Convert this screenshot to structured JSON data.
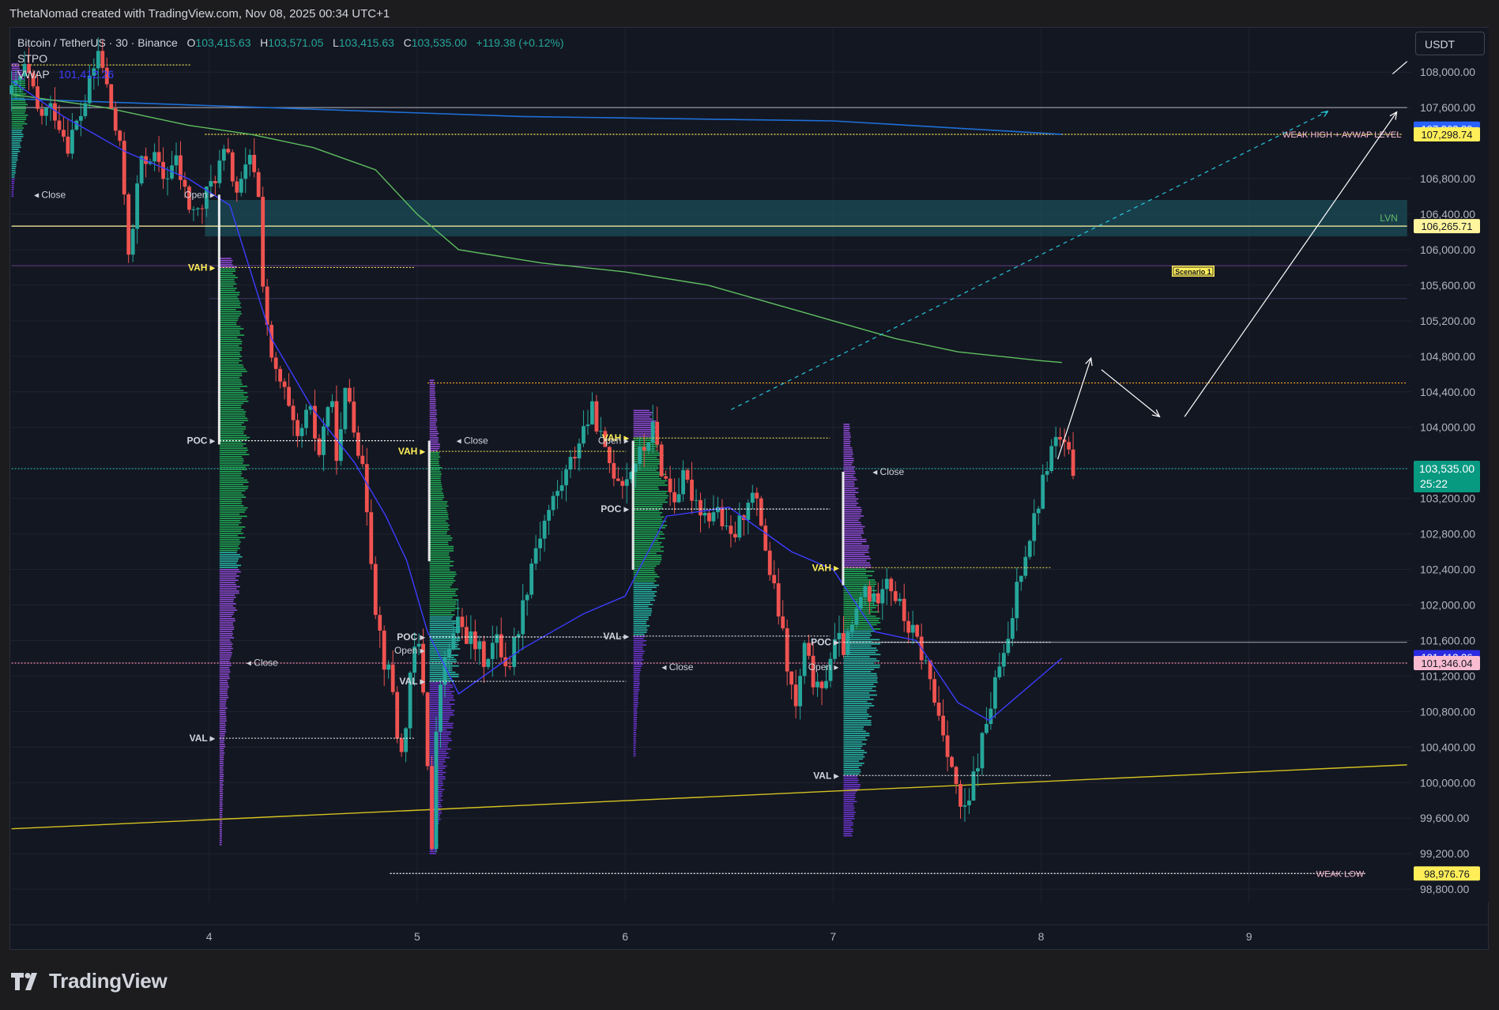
{
  "caption": "ThetaNomad created with TradingView.com, Nov 08, 2025 00:34 UTC+1",
  "brand": "TradingView",
  "currency": "USDT",
  "legend": {
    "symbol": "Bitcoin / TetherUS · 30 · Binance",
    "o_key": "O",
    "o_val": "103,415.63",
    "h_key": "H",
    "h_val": "103,571.05",
    "l_key": "L",
    "l_val": "103,415.63",
    "c_key": "C",
    "c_val": "103,535.00",
    "change": "+119.38 (+0.12%)",
    "ind1": "STPO",
    "ind2": "VWAP",
    "ind2_val": "101,412.26"
  },
  "colors": {
    "bg": "#131722",
    "grid": "#1f2330",
    "up": "#26a69a",
    "down": "#ef5350",
    "vwap": "#3d3dff",
    "avwap": "#5fbf5f",
    "blue_level": "#1e6fd6",
    "yellow": "#ffee58",
    "text": "#d1d4dc",
    "axis_text": "#b2b5be"
  },
  "chart_data": {
    "type": "candlestick",
    "symbol": "Bitcoin / TetherUS",
    "interval": "30",
    "exchange": "Binance",
    "ylim": [
      98650,
      108500
    ],
    "xlim": [
      3.04,
      9.78
    ],
    "y_ticks": [
      "108,000.00",
      "107,600.00",
      "106,800.00",
      "106,400.00",
      "106,000.00",
      "105,600.00",
      "105,200.00",
      "104,800.00",
      "104,400.00",
      "104,000.00",
      "103,200.00",
      "102,800.00",
      "102,400.00",
      "102,000.00",
      "101,600.00",
      "101,200.00",
      "100,800.00",
      "100,400.00",
      "100,000.00",
      "99,600.00",
      "99,200.00",
      "98,800.00"
    ],
    "x_ticks": [
      {
        "x": 4,
        "label": "4"
      },
      {
        "x": 5,
        "label": "5"
      },
      {
        "x": 6,
        "label": "6"
      },
      {
        "x": 7,
        "label": "7"
      },
      {
        "x": 8,
        "label": "8"
      },
      {
        "x": 9,
        "label": "9"
      }
    ],
    "price_path": [
      [
        3.05,
        107750
      ],
      [
        3.12,
        108050
      ],
      [
        3.18,
        107500
      ],
      [
        3.25,
        107600
      ],
      [
        3.32,
        107200
      ],
      [
        3.38,
        107500
      ],
      [
        3.42,
        107800
      ],
      [
        3.47,
        108250
      ],
      [
        3.52,
        107700
      ],
      [
        3.58,
        107000
      ],
      [
        3.62,
        105800
      ],
      [
        3.66,
        106900
      ],
      [
        3.72,
        107100
      ],
      [
        3.78,
        106800
      ],
      [
        3.84,
        107000
      ],
      [
        3.9,
        106500
      ],
      [
        3.95,
        106400
      ],
      [
        4.02,
        106800
      ],
      [
        4.08,
        107100
      ],
      [
        4.14,
        106600
      ],
      [
        4.19,
        107000
      ],
      [
        4.23,
        106900
      ],
      [
        4.26,
        105600
      ],
      [
        4.3,
        104700
      ],
      [
        4.36,
        104400
      ],
      [
        4.42,
        103800
      ],
      [
        4.48,
        104200
      ],
      [
        4.53,
        103700
      ],
      [
        4.58,
        104400
      ],
      [
        4.62,
        103600
      ],
      [
        4.66,
        104500
      ],
      [
        4.71,
        103900
      ],
      [
        4.76,
        103100
      ],
      [
        4.8,
        102000
      ],
      [
        4.84,
        101400
      ],
      [
        4.88,
        101100
      ],
      [
        4.92,
        100200
      ],
      [
        4.96,
        101000
      ],
      [
        5.0,
        101700
      ],
      [
        5.04,
        100800
      ],
      [
        5.07,
        99200
      ],
      [
        5.1,
        101000
      ],
      [
        5.15,
        101500
      ],
      [
        5.2,
        101800
      ],
      [
        5.26,
        101600
      ],
      [
        5.32,
        101400
      ],
      [
        5.38,
        101600
      ],
      [
        5.44,
        101300
      ],
      [
        5.5,
        101900
      ],
      [
        5.56,
        102600
      ],
      [
        5.62,
        103000
      ],
      [
        5.68,
        103300
      ],
      [
        5.74,
        103600
      ],
      [
        5.8,
        104000
      ],
      [
        5.85,
        104200
      ],
      [
        5.9,
        103700
      ],
      [
        5.95,
        103500
      ],
      [
        6.0,
        103400
      ],
      [
        6.04,
        103600
      ],
      [
        6.08,
        103700
      ],
      [
        6.13,
        104000
      ],
      [
        6.18,
        103500
      ],
      [
        6.23,
        103200
      ],
      [
        6.28,
        103400
      ],
      [
        6.34,
        103200
      ],
      [
        6.39,
        103000
      ],
      [
        6.44,
        103100
      ],
      [
        6.5,
        102700
      ],
      [
        6.55,
        102900
      ],
      [
        6.6,
        103300
      ],
      [
        6.65,
        103000
      ],
      [
        6.7,
        102300
      ],
      [
        6.74,
        101900
      ],
      [
        6.78,
        101300
      ],
      [
        6.82,
        100800
      ],
      [
        6.86,
        101500
      ],
      [
        6.9,
        101200
      ],
      [
        6.94,
        100900
      ],
      [
        6.98,
        101400
      ],
      [
        7.02,
        101600
      ],
      [
        7.06,
        101500
      ],
      [
        7.1,
        101800
      ],
      [
        7.15,
        102200
      ],
      [
        7.2,
        102000
      ],
      [
        7.25,
        102400
      ],
      [
        7.3,
        102100
      ],
      [
        7.35,
        101800
      ],
      [
        7.4,
        101600
      ],
      [
        7.45,
        101300
      ],
      [
        7.49,
        100900
      ],
      [
        7.53,
        100600
      ],
      [
        7.57,
        100200
      ],
      [
        7.6,
        99800
      ],
      [
        7.64,
        99600
      ],
      [
        7.68,
        100100
      ],
      [
        7.72,
        100500
      ],
      [
        7.76,
        100900
      ],
      [
        7.8,
        101300
      ],
      [
        7.84,
        101500
      ],
      [
        7.88,
        102200
      ],
      [
        7.92,
        102600
      ],
      [
        7.96,
        102900
      ],
      [
        8.0,
        103300
      ],
      [
        8.04,
        103700
      ],
      [
        8.08,
        103900
      ],
      [
        8.12,
        103700
      ],
      [
        8.16,
        103500
      ]
    ],
    "vwap_path": [
      [
        3.05,
        107900
      ],
      [
        3.3,
        107500
      ],
      [
        3.6,
        107100
      ],
      [
        3.9,
        106800
      ],
      [
        4.1,
        106500
      ],
      [
        4.3,
        105000
      ],
      [
        4.5,
        104200
      ],
      [
        4.7,
        103600
      ],
      [
        4.85,
        103000
      ],
      [
        4.95,
        102500
      ],
      [
        5.05,
        101700
      ],
      [
        5.2,
        101000
      ],
      [
        5.5,
        101500
      ],
      [
        5.8,
        101900
      ],
      [
        6.0,
        102100
      ],
      [
        6.2,
        103000
      ],
      [
        6.5,
        103100
      ],
      [
        6.8,
        102600
      ],
      [
        7.0,
        102400
      ],
      [
        7.2,
        101700
      ],
      [
        7.4,
        101600
      ],
      [
        7.6,
        100900
      ],
      [
        7.75,
        100700
      ],
      [
        7.9,
        101000
      ],
      [
        8.0,
        101200
      ],
      [
        8.1,
        101400
      ]
    ],
    "avwap_path": [
      [
        3.05,
        107750
      ],
      [
        3.5,
        107600
      ],
      [
        3.9,
        107400
      ],
      [
        4.2,
        107300
      ],
      [
        4.5,
        107150
      ],
      [
        4.8,
        106900
      ],
      [
        5.0,
        106400
      ],
      [
        5.2,
        106000
      ],
      [
        5.6,
        105850
      ],
      [
        6.0,
        105750
      ],
      [
        6.4,
        105600
      ],
      [
        6.7,
        105400
      ],
      [
        7.0,
        105200
      ],
      [
        7.3,
        105000
      ],
      [
        7.6,
        104850
      ],
      [
        8.0,
        104750
      ],
      [
        8.1,
        104730
      ]
    ],
    "blue_level_path": [
      [
        3.05,
        107700
      ],
      [
        5.5,
        107500
      ],
      [
        7.0,
        107450
      ],
      [
        8.1,
        107300
      ]
    ],
    "trendline": {
      "from": [
        3.05,
        99480
      ],
      "to": [
        9.76,
        100200
      ]
    },
    "levels": [
      {
        "price": 107600,
        "x1": 3.05,
        "x2": 9.76,
        "color": "#9598a1",
        "style": "solid"
      },
      {
        "price": 107298.74,
        "x1": 3.98,
        "x2": 9.74,
        "color": "#ffee58",
        "style": "dotted",
        "label": "WEAK HIGH + AVWAP LEVEL"
      },
      {
        "price": 108080,
        "x1": 3.05,
        "x2": 3.91,
        "color": "#ffee58",
        "style": "dotted"
      },
      {
        "price": 106265.71,
        "x1": 3.05,
        "x2": 9.76,
        "color": "#fff59d",
        "style": "solid"
      },
      {
        "price": 105820,
        "x1": 3.05,
        "x2": 9.76,
        "color": "#5c3c7a",
        "style": "solid"
      },
      {
        "price": 105450,
        "x1": 4.0,
        "x2": 9.76,
        "color": "#3a2f55",
        "style": "solid"
      },
      {
        "price": 104500,
        "x1": 5.05,
        "x2": 9.76,
        "color": "#ffa726",
        "style": "dotted"
      },
      {
        "price": 103535,
        "x1": 3.05,
        "x2": 9.76,
        "color": "#26a69a",
        "style": "dotted"
      },
      {
        "price": 101580,
        "x1": 7.0,
        "x2": 9.76,
        "color": "#9598a1",
        "style": "solid"
      },
      {
        "price": 101346.04,
        "x1": 3.05,
        "x2": 9.76,
        "color": "#f48fb1",
        "style": "dotted"
      },
      {
        "price": 98976.76,
        "x1": 4.87,
        "x2": 9.56,
        "color": "#ffffff",
        "style": "dotted",
        "label": "WEAK LOW"
      }
    ],
    "lvn_zone": {
      "y1": 106150,
      "y2": 106560,
      "x1": 3.98,
      "x2": 9.76,
      "label": "LVN"
    },
    "scenario": {
      "x": 8.64,
      "y": 105750,
      "label": "Scenario 1"
    },
    "tpo_profiles": [
      {
        "x": 3.05,
        "day_x": 3.91,
        "vah": 107900,
        "poc": 107600,
        "val": 106800,
        "close": 106620,
        "open": null,
        "mid_min": 106600,
        "mid_max": 108100,
        "width": 0.07
      },
      {
        "x": 4.05,
        "day_x": 5.0,
        "vah": 105800,
        "poc": 103850,
        "val": 100500,
        "close": 101350,
        "open": 106620,
        "mid_min": 99300,
        "mid_max": 105900,
        "width": 0.13
      },
      {
        "x": 5.06,
        "day_x": 6.02,
        "vah": 103730,
        "poc": 101640,
        "val": 101140,
        "close": 103850,
        "open": 101490,
        "mid_min": 99200,
        "mid_max": 104550,
        "width": 0.13
      },
      {
        "x": 6.04,
        "day_x": 7.0,
        "vah": 103880,
        "poc": 103080,
        "val": 101650,
        "close": 101300,
        "open": 103850,
        "mid_min": 100300,
        "mid_max": 104200,
        "width": 0.15
      },
      {
        "x": 7.05,
        "day_x": 8.06,
        "vah": 102420,
        "poc": 101580,
        "val": 100080,
        "close": 103500,
        "open": 101300,
        "mid_min": 99400,
        "mid_max": 104050,
        "width": 0.16
      }
    ],
    "tpo_labels": {
      "vah": "VAH",
      "poc": "POC",
      "val": "VAL",
      "open": "Open",
      "close": "Close"
    },
    "scenario_arrows": [
      [
        [
          8.08,
          103640
        ],
        [
          8.24,
          104780
        ]
      ],
      [
        [
          8.29,
          104650
        ],
        [
          8.57,
          104120
        ]
      ],
      [
        [
          8.69,
          104120
        ],
        [
          9.71,
          107550
        ]
      ]
    ],
    "dashed_projection": {
      "from": [
        6.51,
        104200
      ],
      "to": [
        9.38,
        107560
      ],
      "color": "#26c6da"
    },
    "short_line": {
      "from": [
        9.69,
        108050
      ],
      "to": [
        9.76,
        108120
      ]
    },
    "price_tags": [
      {
        "price": 107362.89,
        "text": "107,362.89",
        "bg": "#2962ff",
        "fg": "#ffffff"
      },
      {
        "price": 107298.74,
        "text": "107,298.74",
        "bg": "#ffee58",
        "fg": "#131722"
      },
      {
        "price": 106265.71,
        "text": "106,265.71",
        "bg": "#fff59d",
        "fg": "#131722"
      },
      {
        "price": 101412.26,
        "text": "101,412.26",
        "bg": "#2a2ae0",
        "fg": "#ffffff"
      },
      {
        "price": 101346.04,
        "text": "101,346.04",
        "bg": "#f8bbd0",
        "fg": "#131722"
      },
      {
        "price": 98976.76,
        "text": "98,976.76",
        "bg": "#ffee58",
        "fg": "#131722"
      }
    ],
    "last_price": {
      "price": 103535.0,
      "text": "103,535.00",
      "countdown": "25:22",
      "bg": "#089981"
    }
  }
}
